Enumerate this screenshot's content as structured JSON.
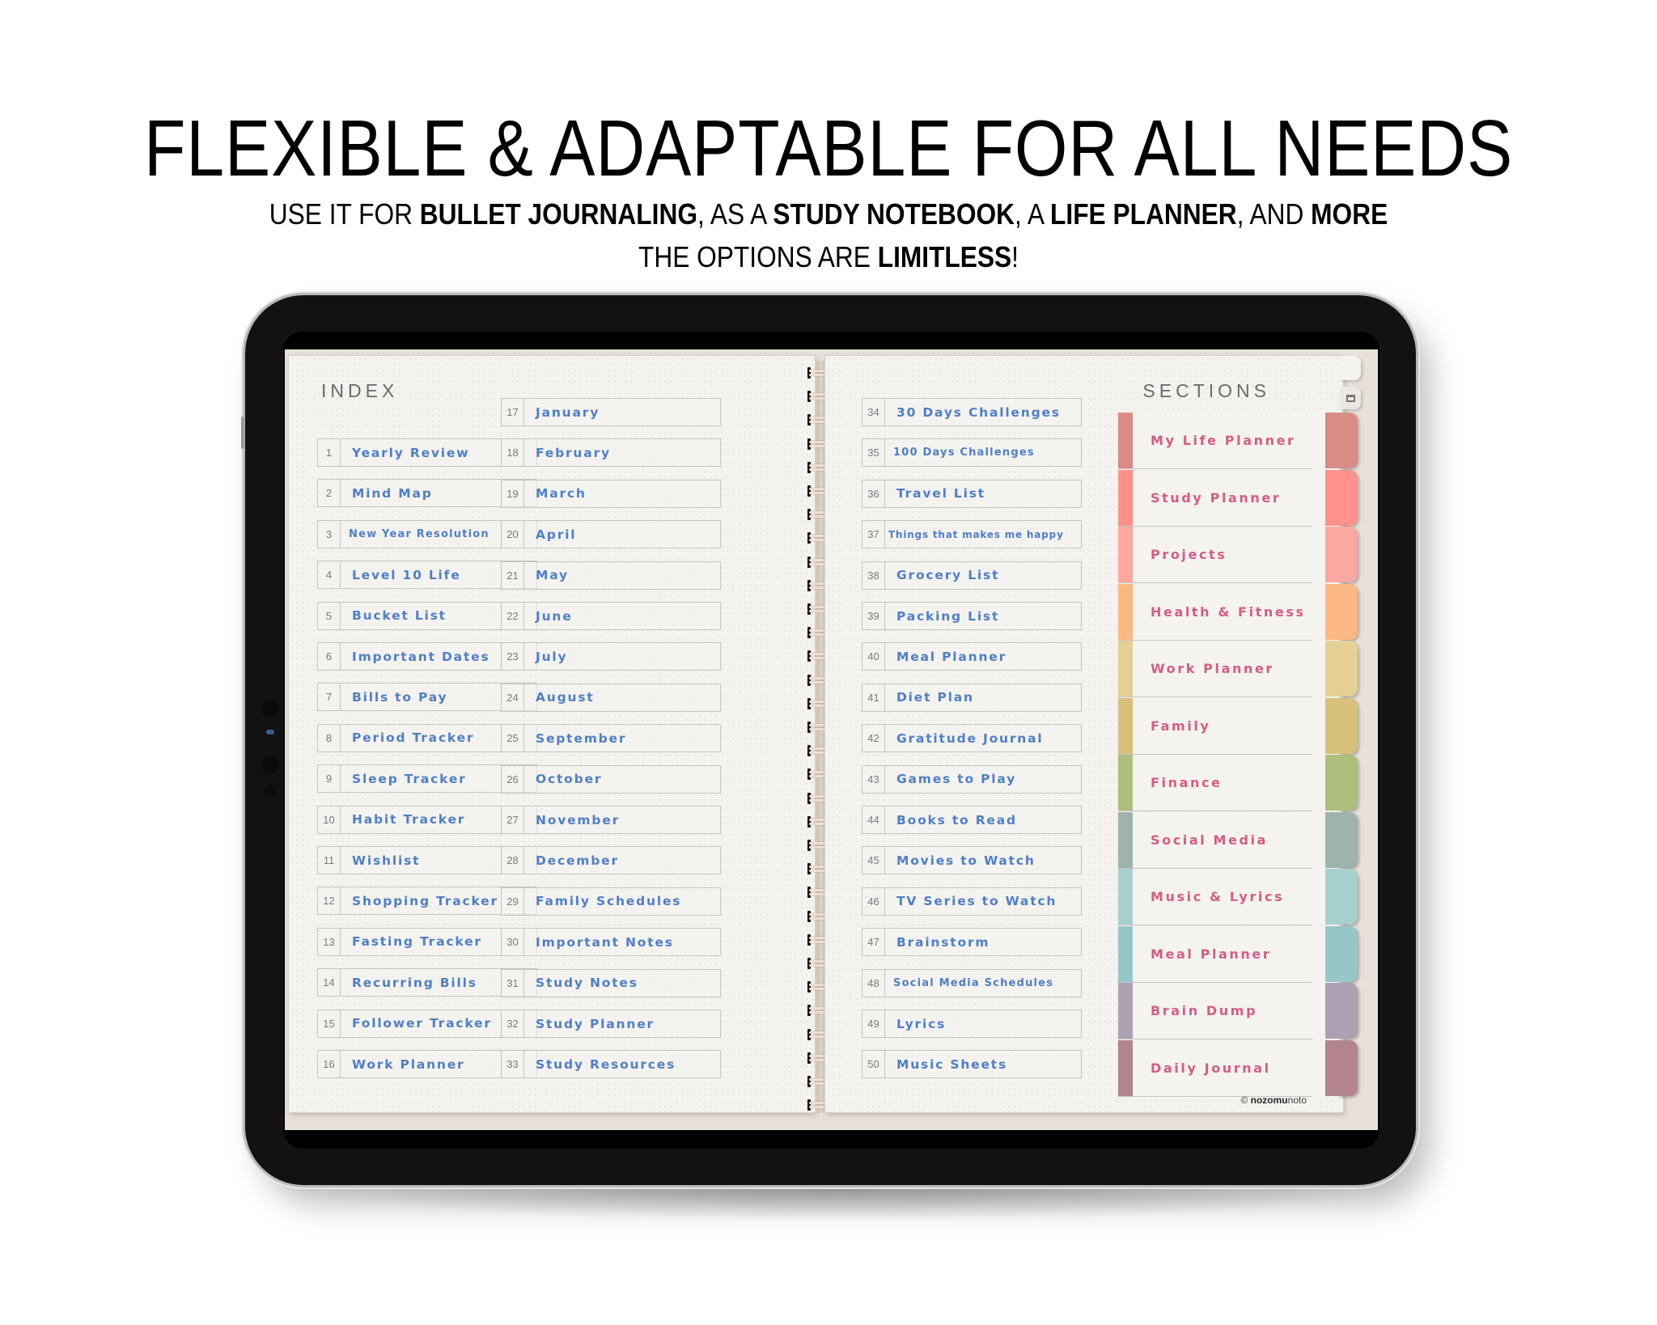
{
  "header": {
    "headline": "FLEXIBLE & ADAPTABLE FOR ALL NEEDS",
    "subline1": [
      {
        "text": "USE IT FOR ",
        "bold": false
      },
      {
        "text": "BULLET JOURNALING",
        "bold": true
      },
      {
        "text": ", AS A ",
        "bold": false
      },
      {
        "text": "STUDY NOTEBOOK",
        "bold": true
      },
      {
        "text": ", A ",
        "bold": false
      },
      {
        "text": "LIFE PLANNER",
        "bold": true
      },
      {
        "text": ", AND ",
        "bold": false
      },
      {
        "text": "MORE",
        "bold": true
      }
    ],
    "subline2": [
      {
        "text": "THE OPTIONS ARE ",
        "bold": false
      },
      {
        "text": "LIMITLESS",
        "bold": true
      },
      {
        "text": "!",
        "bold": false
      }
    ]
  },
  "planner": {
    "index_title": "INDEX",
    "sections_title": "SECTIONS",
    "index_items": [
      {
        "num": "1",
        "label": "Yearly Review"
      },
      {
        "num": "2",
        "label": "Mind Map"
      },
      {
        "num": "3",
        "label": "New Year Resolution"
      },
      {
        "num": "4",
        "label": "Level 10 Life"
      },
      {
        "num": "5",
        "label": "Bucket List"
      },
      {
        "num": "6",
        "label": "Important Dates"
      },
      {
        "num": "7",
        "label": "Bills to Pay"
      },
      {
        "num": "8",
        "label": "Period Tracker"
      },
      {
        "num": "9",
        "label": "Sleep Tracker"
      },
      {
        "num": "10",
        "label": "Habit Tracker"
      },
      {
        "num": "11",
        "label": "Wishlist"
      },
      {
        "num": "12",
        "label": "Shopping Tracker"
      },
      {
        "num": "13",
        "label": "Fasting Tracker"
      },
      {
        "num": "14",
        "label": "Recurring Bills"
      },
      {
        "num": "15",
        "label": "Follower Tracker"
      },
      {
        "num": "16",
        "label": "Work Planner"
      },
      {
        "num": "17",
        "label": "January"
      },
      {
        "num": "18",
        "label": "February"
      },
      {
        "num": "19",
        "label": "March"
      },
      {
        "num": "20",
        "label": "April"
      },
      {
        "num": "21",
        "label": "May"
      },
      {
        "num": "22",
        "label": "June"
      },
      {
        "num": "23",
        "label": "July"
      },
      {
        "num": "24",
        "label": "August"
      },
      {
        "num": "25",
        "label": "September"
      },
      {
        "num": "26",
        "label": "October"
      },
      {
        "num": "27",
        "label": "November"
      },
      {
        "num": "28",
        "label": "December"
      },
      {
        "num": "29",
        "label": "Family Schedules"
      },
      {
        "num": "30",
        "label": "Important Notes"
      },
      {
        "num": "31",
        "label": "Study Notes"
      },
      {
        "num": "32",
        "label": "Study Planner"
      },
      {
        "num": "33",
        "label": "Study Resources"
      },
      {
        "num": "34",
        "label": "30 Days Challenges"
      },
      {
        "num": "35",
        "label": "100 Days Challenges"
      },
      {
        "num": "36",
        "label": "Travel List"
      },
      {
        "num": "37",
        "label": "Things that makes me happy"
      },
      {
        "num": "38",
        "label": "Grocery List"
      },
      {
        "num": "39",
        "label": "Packing List"
      },
      {
        "num": "40",
        "label": "Meal Planner"
      },
      {
        "num": "41",
        "label": "Diet Plan"
      },
      {
        "num": "42",
        "label": "Gratitude Journal"
      },
      {
        "num": "43",
        "label": "Games to Play"
      },
      {
        "num": "44",
        "label": "Books to Read"
      },
      {
        "num": "45",
        "label": "Movies to Watch"
      },
      {
        "num": "46",
        "label": "TV Series to Watch"
      },
      {
        "num": "47",
        "label": "Brainstorm"
      },
      {
        "num": "48",
        "label": "Social Media Schedules"
      },
      {
        "num": "49",
        "label": "Lyrics"
      },
      {
        "num": "50",
        "label": "Music Sheets"
      }
    ],
    "sections": [
      {
        "label": "My Life Planner",
        "color": "#d98c86"
      },
      {
        "label": "Study Planner",
        "color": "#ff918b"
      },
      {
        "label": "Projects",
        "color": "#fca8a0"
      },
      {
        "label": "Health & Fitness",
        "color": "#fdb883"
      },
      {
        "label": "Work Planner",
        "color": "#e4cf94"
      },
      {
        "label": "Family",
        "color": "#d7c07a"
      },
      {
        "label": "Finance",
        "color": "#adbe7c"
      },
      {
        "label": "Social Media",
        "color": "#9db3ab"
      },
      {
        "label": "Music & Lyrics",
        "color": "#a8d0cf"
      },
      {
        "label": "Meal Planner",
        "color": "#97c6c9"
      },
      {
        "label": "Brain Dump",
        "color": "#ae9fb3"
      },
      {
        "label": "Daily Journal",
        "color": "#b2848f"
      }
    ],
    "copyright_symbol": "©",
    "copyright_bold": "nozomu",
    "copyright_light": "noto"
  },
  "colors": {
    "index_text": "#4f7fc6",
    "section_text": "#d45d84",
    "paper": "#f4f3ef",
    "planner_bg": "#e7e0d8"
  }
}
